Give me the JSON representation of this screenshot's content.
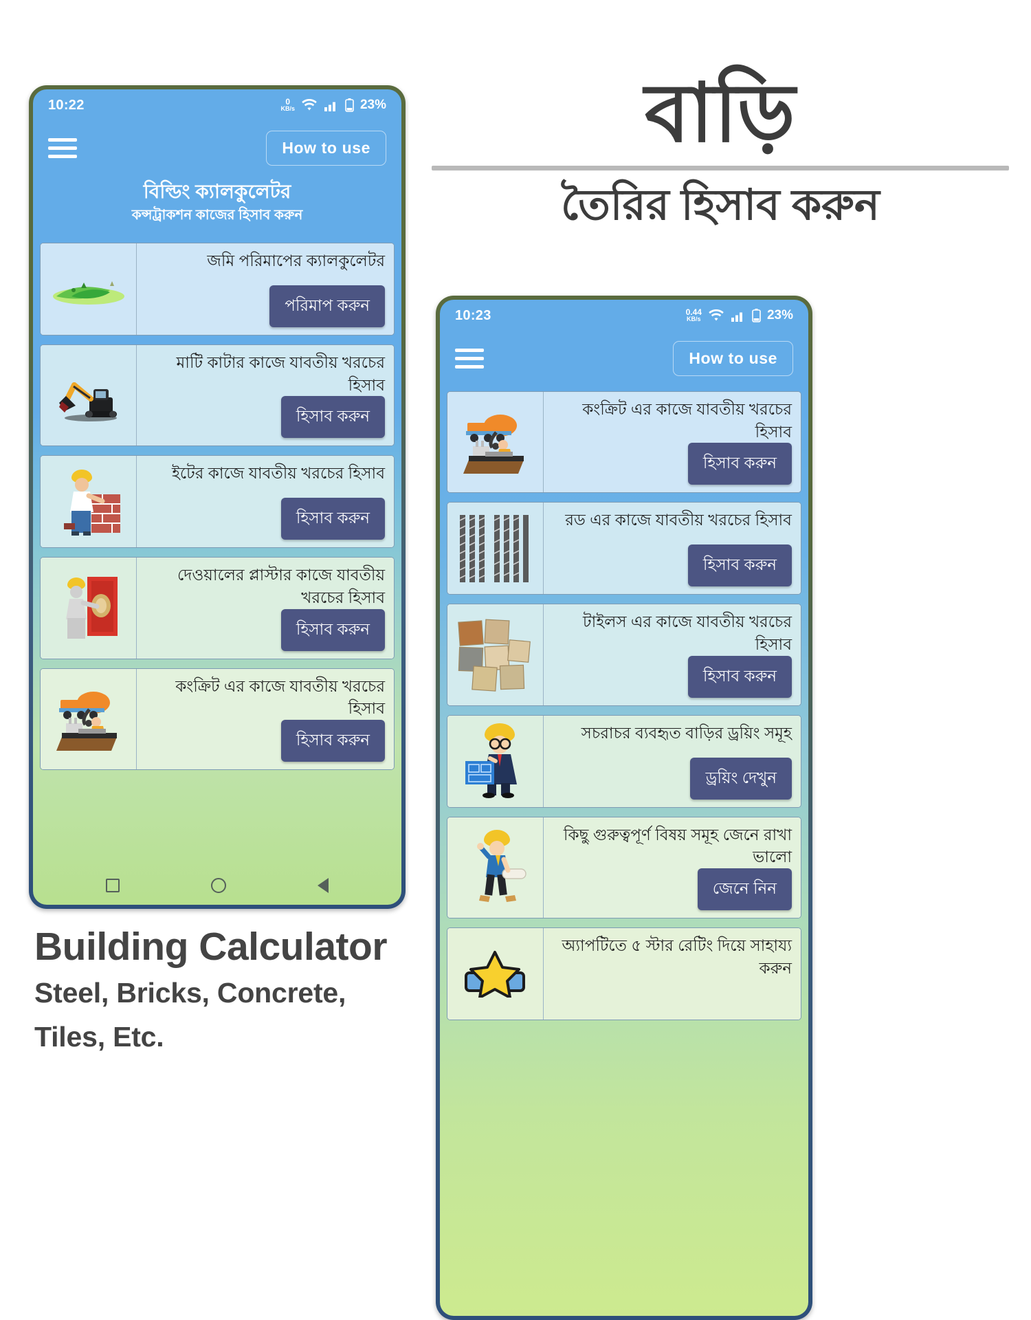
{
  "poster": {
    "right_heading": "বাড়ি",
    "right_subheading": "তৈরির হিসাব করুন",
    "caption_title": "Building Calculator",
    "caption_line1": "Steel, Bricks, Concrete,",
    "caption_line2": "Tiles, Etc.",
    "rule_color": "#b9b9b9",
    "text_color": "#3c3c3c"
  },
  "colors": {
    "appbar": "#63ace8",
    "button": "#4c5583",
    "frame_top": "#57693c",
    "frame_bottom": "#2d4f7a"
  },
  "phone_left": {
    "status": {
      "time": "10:22",
      "net_rate": "0",
      "net_unit": "KB/s",
      "battery": "23%",
      "wifi_icon": "wifi-icon",
      "signal_icon": "signal-bars-icon",
      "battery_icon": "battery-icon"
    },
    "appbar": {
      "menu_icon": "hamburger-menu-icon",
      "how_to_use": "How to use"
    },
    "title": "বিল্ডিং ক্যালকুলেটর",
    "subtitle": "কন্সট্রাকশন কাজের হিসাব করুন",
    "cards": [
      {
        "title": "জমি পরিমাপের ক্যালকুলেটর",
        "button": "পরিমাপ করুন",
        "icon": "land-field-icon"
      },
      {
        "title": "মাটি কাটার কাজে যাবতীয় খরচের হিসাব",
        "button": "হিসাব করুন",
        "icon": "excavator-icon"
      },
      {
        "title": "ইটের কাজে যাবতীয় খরচের হিসাব",
        "button": "হিসাব করুন",
        "icon": "bricklayer-icon"
      },
      {
        "title": "দেওয়ালের প্লাস্টার কাজে যাবতীয় খরচের হিসাব",
        "button": "হিসাব করুন",
        "icon": "plastering-worker-icon"
      },
      {
        "title": "কংক্রিট এর কাজে যাবতীয় খরচের হিসাব",
        "button": "হিসাব করুন",
        "icon": "concrete-mixer-icon"
      }
    ],
    "navbar": {
      "recent_icon": "square-recent-apps-icon",
      "home_icon": "circle-home-icon",
      "back_icon": "triangle-back-icon"
    }
  },
  "phone_right": {
    "status": {
      "time": "10:23",
      "net_rate": "0.44",
      "net_unit": "KB/s",
      "battery": "23%",
      "wifi_icon": "wifi-icon",
      "signal_icon": "signal-bars-icon",
      "battery_icon": "battery-icon"
    },
    "appbar": {
      "menu_icon": "hamburger-menu-icon",
      "how_to_use": "How to use"
    },
    "cards": [
      {
        "title": "কংক্রিট এর কাজে যাবতীয় খরচের হিসাব",
        "button": "হিসাব করুন",
        "icon": "concrete-mixer-icon"
      },
      {
        "title": "রড এর কাজে যাবতীয় খরচের হিসাব",
        "button": "হিসাব করুন",
        "icon": "steel-rods-icon"
      },
      {
        "title": "টাইলস এর কাজে যাবতীয় খরচের হিসাব",
        "button": "হিসাব করুন",
        "icon": "tiles-icon"
      },
      {
        "title": "সচরাচর ব্যবহৃত বাড়ির ড্রয়িং সমূহ",
        "button": "ড্রয়িং দেখুন",
        "icon": "engineer-blueprint-icon"
      },
      {
        "title": "কিছু গুরুত্বপূর্ণ বিষয় সমূহ জেনে রাখা ভালো",
        "button": "জেনে নিন",
        "icon": "worker-walking-icon"
      },
      {
        "title": "অ্যাপটিতে ৫ স্টার রেটিং দিয়ে সাহায্য করুন",
        "button": "",
        "icon": "star-rating-icon"
      }
    ]
  }
}
